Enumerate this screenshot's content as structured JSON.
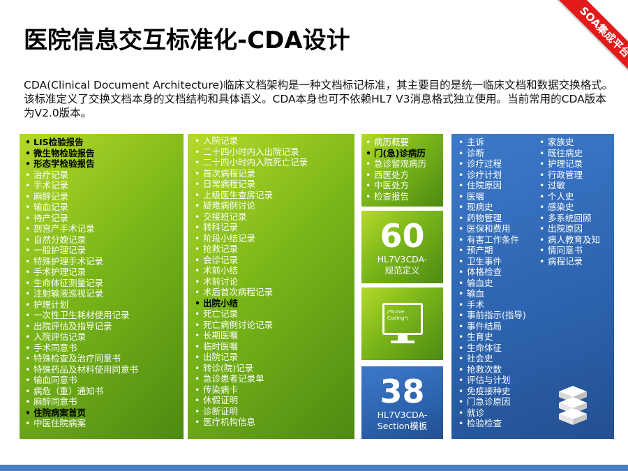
{
  "title": "医院信息交互标准化-CDA设计",
  "ribbon": "SOA集成平台",
  "intro": "CDA(Clinical Document Architecture)临床文档架构是一种文档标记标准，其主要目的是统一临床文档和数据交换格式。该标准定义了交换文档本身的文档结构和具体语义。CDA本身也可不依赖HL7 V3消息格式独立使用。当前常用的CDA版本为V2.0版本。",
  "col1": [
    {
      "t": "LIS检验报告",
      "b": true
    },
    {
      "t": "微生物检验报告",
      "b": true
    },
    {
      "t": "形态学检验报告",
      "b": true
    },
    {
      "t": "治疗记录",
      "b": false
    },
    {
      "t": "手术记录",
      "b": false
    },
    {
      "t": "麻醉记录",
      "b": false
    },
    {
      "t": "输血记录",
      "b": false
    },
    {
      "t": "待产记录",
      "b": false
    },
    {
      "t": "剖宫产手术记录",
      "b": false
    },
    {
      "t": "自然分娩记录",
      "b": false
    },
    {
      "t": "一般护理记录",
      "b": false
    },
    {
      "t": "特殊护理手术记录",
      "b": false
    },
    {
      "t": "手术护理记录",
      "b": false
    },
    {
      "t": "生命体征测量记录",
      "b": false
    },
    {
      "t": "注射输液巡视记录",
      "b": false
    },
    {
      "t": "护理计划",
      "b": false
    },
    {
      "t": "一次性卫生耗材使用记录",
      "b": false
    },
    {
      "t": "出院评估及指导记录",
      "b": false
    },
    {
      "t": "入院评估记录",
      "b": false
    },
    {
      "t": "手术同意书",
      "b": false
    },
    {
      "t": "特殊检查及治疗同意书",
      "b": false
    },
    {
      "t": "特殊药品及材料使用同意书",
      "b": false
    },
    {
      "t": "输血同意书",
      "b": false
    },
    {
      "t": "病危（重）通知书",
      "b": false
    },
    {
      "t": "麻醉同意书",
      "b": false
    },
    {
      "t": "住院病案首页",
      "b": true
    },
    {
      "t": "中医住院病案",
      "b": false
    }
  ],
  "col2": [
    {
      "t": "入院记录",
      "b": false
    },
    {
      "t": "二十四小时内入出院记录",
      "b": false
    },
    {
      "t": "二十四小时内入院死亡记录",
      "b": false
    },
    {
      "t": "首次病程记录",
      "b": false
    },
    {
      "t": "日常病程记录",
      "b": false
    },
    {
      "t": "上级医生查房记录",
      "b": false
    },
    {
      "t": "疑难病例讨论",
      "b": false
    },
    {
      "t": "交接班记录",
      "b": false
    },
    {
      "t": "转科记录",
      "b": false
    },
    {
      "t": "阶段小结记录",
      "b": false
    },
    {
      "t": "抢救记录",
      "b": false
    },
    {
      "t": "会诊记录",
      "b": false
    },
    {
      "t": "术前小结",
      "b": false
    },
    {
      "t": "术前讨论",
      "b": false
    },
    {
      "t": "术后首次病程记录",
      "b": false
    },
    {
      "t": "出院小结",
      "b": true
    },
    {
      "t": "死亡记录",
      "b": false
    },
    {
      "t": "死亡病例讨论记录",
      "b": false
    },
    {
      "t": "长期医嘱",
      "b": false
    },
    {
      "t": "临时医嘱",
      "b": false
    },
    {
      "t": "出院记录",
      "b": false
    },
    {
      "t": "转诊(院)记录",
      "b": false
    },
    {
      "t": "急诊患者记录单",
      "b": false
    },
    {
      "t": "传染病卡",
      "b": false
    },
    {
      "t": "休假证明",
      "b": false
    },
    {
      "t": "诊断证明",
      "b": false
    },
    {
      "t": "医疗机构信息",
      "b": false
    }
  ],
  "col3": [
    {
      "t": "病历概要",
      "b": false
    },
    {
      "t": "门(急)诊病历",
      "b": true
    },
    {
      "t": "急诊留观病历",
      "b": false
    },
    {
      "t": "西医处方",
      "b": false
    },
    {
      "t": "中医处方",
      "b": false
    },
    {
      "t": "检查报告",
      "b": false
    }
  ],
  "tile60": {
    "num": "60",
    "cap1": "HL7V3CDA-",
    "cap2": "规范定义"
  },
  "monitor": {
    "line1": "/*ILove",
    "line2": "Coding*/"
  },
  "tile38": {
    "num": "38",
    "cap1": "HL7V3CDA-",
    "cap2": "Section模板"
  },
  "col4a": [
    "主诉",
    "诊断",
    "诊疗过程",
    "诊疗计划",
    "住院原因",
    "医嘱",
    "现病史",
    "药物管理",
    "医保和费用",
    "有害工作条件",
    "预产期",
    "卫生事件",
    "体格检查",
    "输血史",
    "输血",
    "手术",
    "事前指示(指导)",
    "事件结局",
    "生育史",
    "生命体征",
    "社会史",
    "抢救次数",
    "评估与计划",
    "免疫接种史",
    "门急诊原因",
    "就诊",
    "检验检查"
  ],
  "col4b": [
    "家族史",
    "既往病史",
    "护理记录",
    "行政管理",
    "过敏",
    "个人史",
    "感染史",
    "多系统回顾",
    "出院原因",
    "病人教育及知",
    "情同意书",
    "病程记录"
  ]
}
